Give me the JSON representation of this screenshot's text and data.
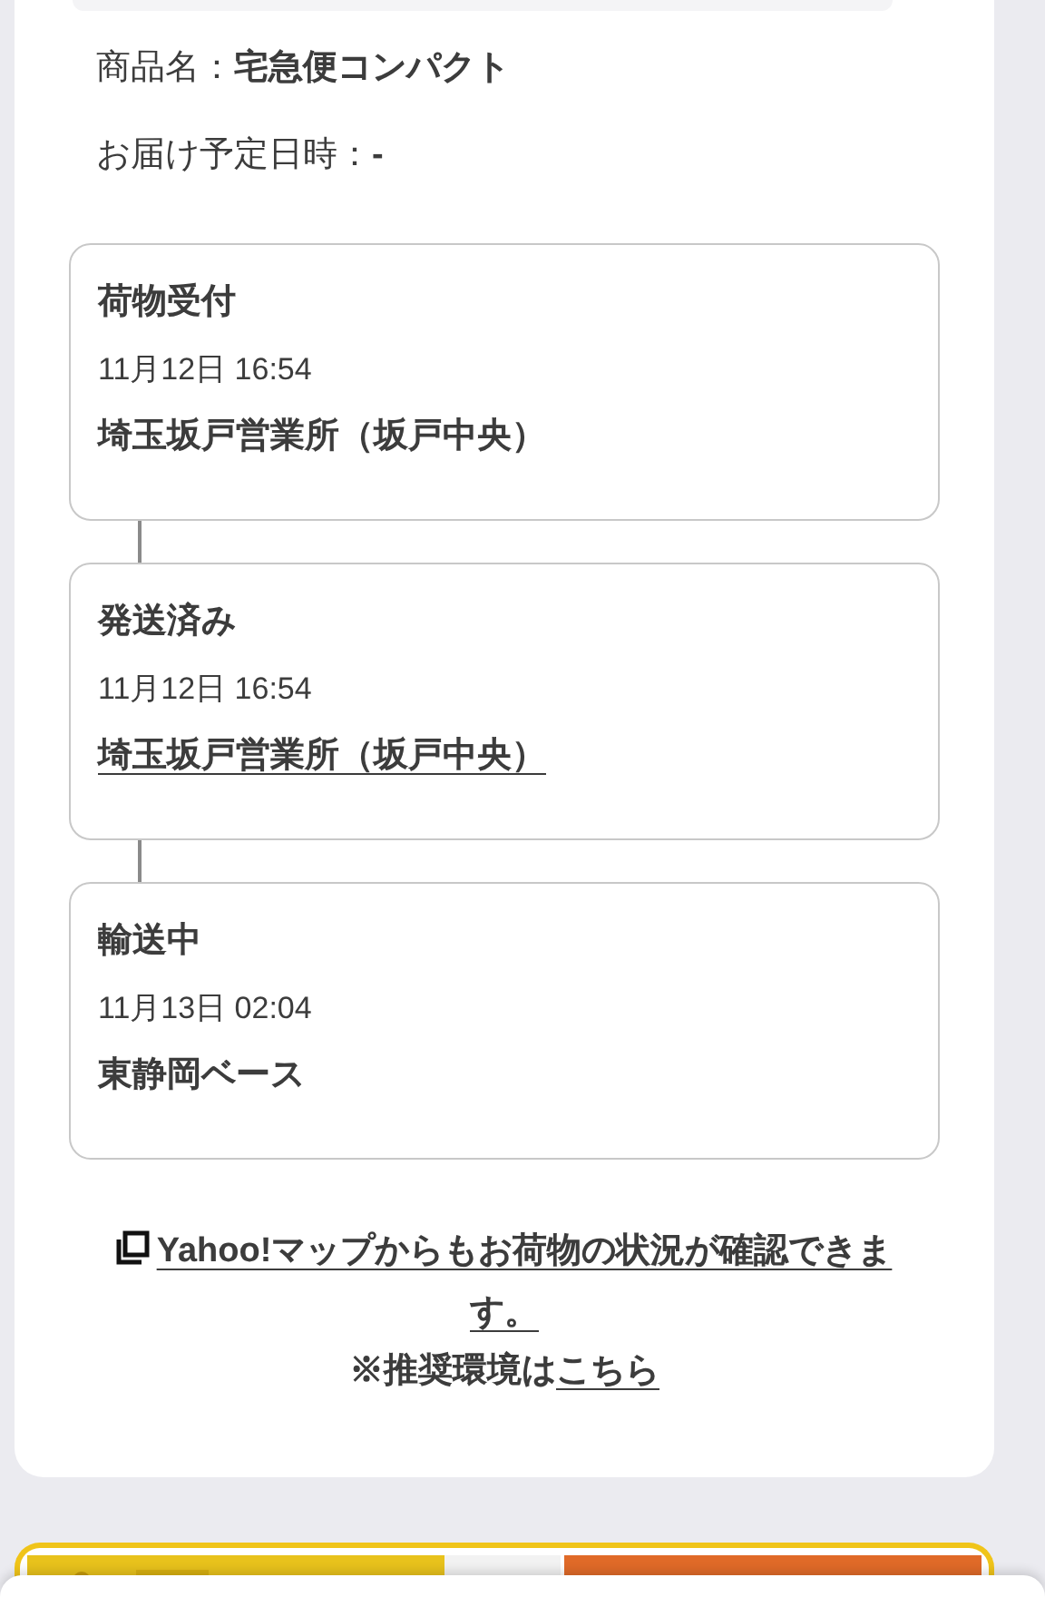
{
  "product": {
    "label": "商品名：",
    "value": "宅急便コンパクト"
  },
  "delivery": {
    "label": "お届け予定日時：",
    "value": "-"
  },
  "steps": [
    {
      "status": "荷物受付",
      "datetime": "11月12日 16:54",
      "location": "埼玉坂戸営業所（坂戸中央）",
      "location_link": false
    },
    {
      "status": "発送済み",
      "datetime": "11月12日 16:54",
      "location": "埼玉坂戸営業所（坂戸中央）",
      "location_link": true
    },
    {
      "status": "輸送中",
      "datetime": "11月13日 02:04",
      "location": "東静岡ベース",
      "location_link": false
    }
  ],
  "map_link": "Yahoo!マップからもお荷物の状況が確認できます。",
  "note": {
    "text": "※推奨環境は",
    "link": "こちら"
  }
}
